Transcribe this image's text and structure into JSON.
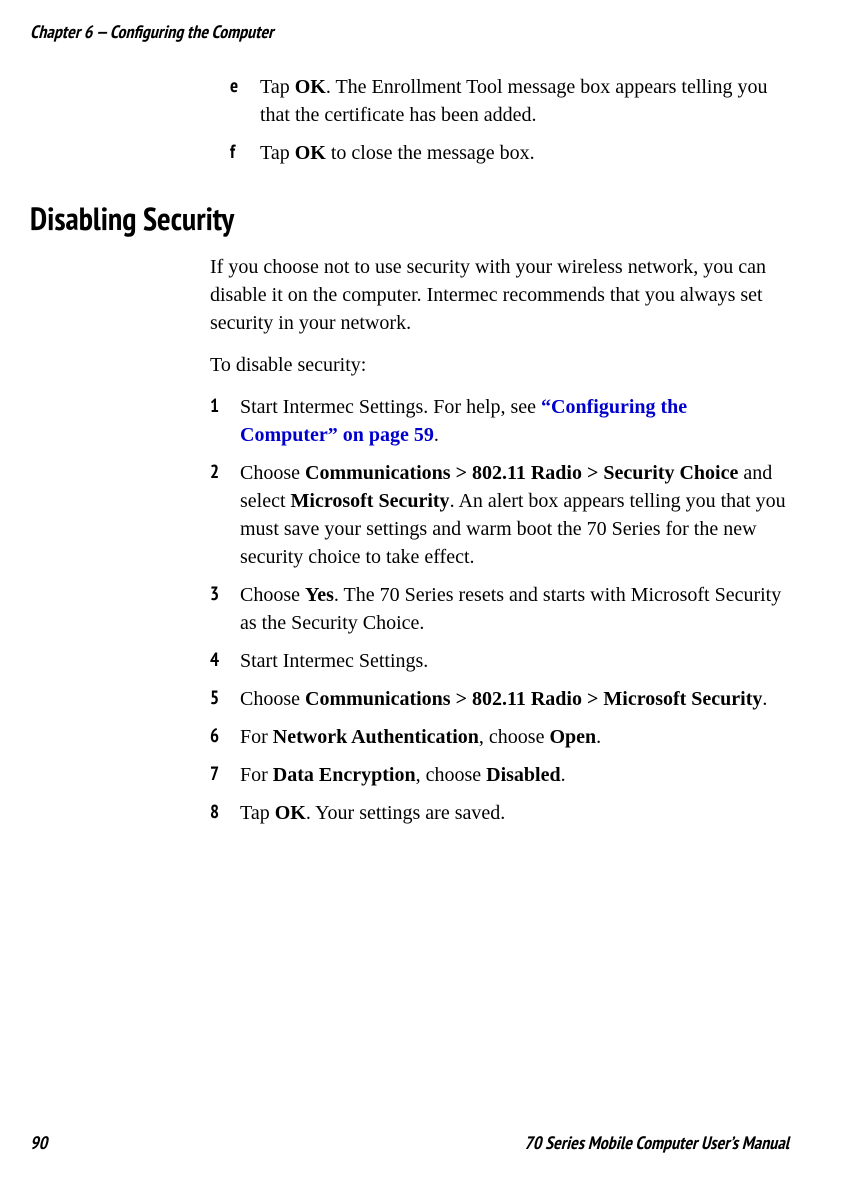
{
  "header": "Chapter 6 — Configuring the Computer",
  "pre_list": [
    {
      "marker": "e",
      "segments": [
        {
          "t": "Tap "
        },
        {
          "t": "OK",
          "b": true
        },
        {
          "t": ". The Enrollment Tool message box appears telling you that the certificate has been added."
        }
      ]
    },
    {
      "marker": "f",
      "segments": [
        {
          "t": "Tap "
        },
        {
          "t": "OK",
          "b": true
        },
        {
          "t": " to close the message box."
        }
      ]
    }
  ],
  "heading": "Disabling Security",
  "paras": [
    "If you choose not to use security with your wireless network, you can disable it on the computer. Intermec recommends that you always set security in your network.",
    "To disable security:"
  ],
  "steps": [
    {
      "marker": "1",
      "segments": [
        {
          "t": "Start Intermec Settings. For help, see "
        },
        {
          "t": "“Configuring the Computer” on page 59",
          "link": true
        },
        {
          "t": "."
        }
      ]
    },
    {
      "marker": "2",
      "segments": [
        {
          "t": "Choose "
        },
        {
          "t": "Communications > 802.11 Radio > Security Choice",
          "b": true
        },
        {
          "t": " and select "
        },
        {
          "t": "Microsoft Security",
          "b": true
        },
        {
          "t": ". An alert box appears telling you that you must save your settings and warm boot the 70 Series for the new security choice to take effect."
        }
      ]
    },
    {
      "marker": "3",
      "segments": [
        {
          "t": "Choose "
        },
        {
          "t": "Yes",
          "b": true
        },
        {
          "t": ". The 70 Series resets and starts with Microsoft Security as the Security Choice."
        }
      ]
    },
    {
      "marker": "4",
      "segments": [
        {
          "t": "Start Intermec Settings."
        }
      ]
    },
    {
      "marker": "5",
      "segments": [
        {
          "t": "Choose "
        },
        {
          "t": "Communications >  802.11 Radio > Microsoft Security",
          "b": true
        },
        {
          "t": "."
        }
      ]
    },
    {
      "marker": "6",
      "segments": [
        {
          "t": "For "
        },
        {
          "t": "Network Authentication",
          "b": true
        },
        {
          "t": ", choose "
        },
        {
          "t": "Open",
          "b": true
        },
        {
          "t": "."
        }
      ]
    },
    {
      "marker": "7",
      "segments": [
        {
          "t": "For "
        },
        {
          "t": "Data Encryption",
          "b": true
        },
        {
          "t": ", choose "
        },
        {
          "t": "Disabled",
          "b": true
        },
        {
          "t": "."
        }
      ]
    },
    {
      "marker": "8",
      "segments": [
        {
          "t": "Tap "
        },
        {
          "t": "OK",
          "b": true
        },
        {
          "t": ". Your settings are saved."
        }
      ]
    }
  ],
  "footer": {
    "left": "90",
    "right": "70 Series Mobile Computer User’s Manual"
  }
}
